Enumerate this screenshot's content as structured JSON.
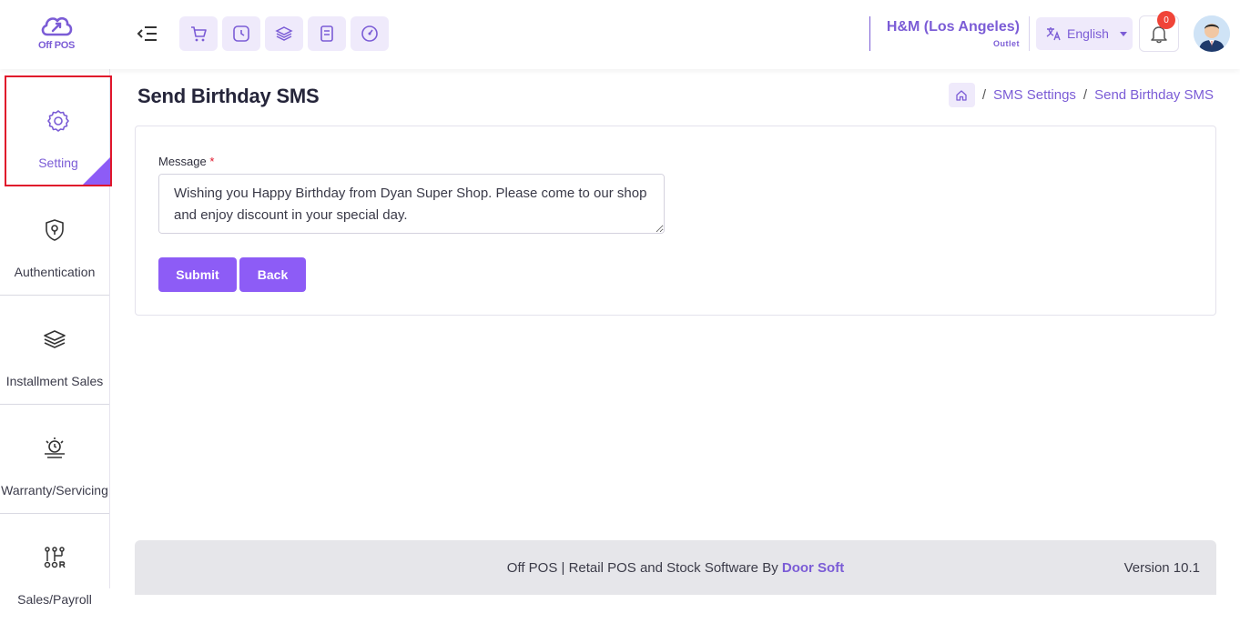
{
  "app": {
    "logo_text": "Off POS"
  },
  "header": {
    "quick_icons": [
      "cart-icon",
      "clock-icon",
      "layers-icon",
      "receipt-icon",
      "dashboard-icon"
    ],
    "outlet_name": "H&M (Los Angeles)",
    "outlet_label": "Outlet",
    "language": "English",
    "notification_count": "0"
  },
  "sidebar": {
    "items": [
      {
        "label": "Setting",
        "icon": "gear-icon",
        "active": true
      },
      {
        "label": "Authentication",
        "icon": "shield-icon"
      },
      {
        "label": "Installment Sales",
        "icon": "layers-icon"
      },
      {
        "label": "Warranty/Servicing",
        "icon": "warranty-icon"
      },
      {
        "label": "Sales/Payroll",
        "icon": "sales-icon"
      }
    ]
  },
  "page": {
    "title": "Send Birthday SMS",
    "breadcrumb": [
      "SMS Settings",
      "Send Birthday SMS"
    ],
    "breadcrumb_sep": "/"
  },
  "form": {
    "message_label": "Message",
    "required_mark": "*",
    "message_value": "Wishing you Happy Birthday from Dyan Super Shop. Please come to our shop and enjoy discount in your special day.",
    "submit_label": "Submit",
    "back_label": "Back"
  },
  "footer": {
    "text_prefix": "Off POS | Retail POS and Stock Software By ",
    "brand": "Door Soft",
    "version": "Version 10.1"
  },
  "colors": {
    "accent": "#8d5cf6",
    "accent_text": "#7b5cd6",
    "active_border": "#e0162b",
    "badge": "#f04438"
  }
}
